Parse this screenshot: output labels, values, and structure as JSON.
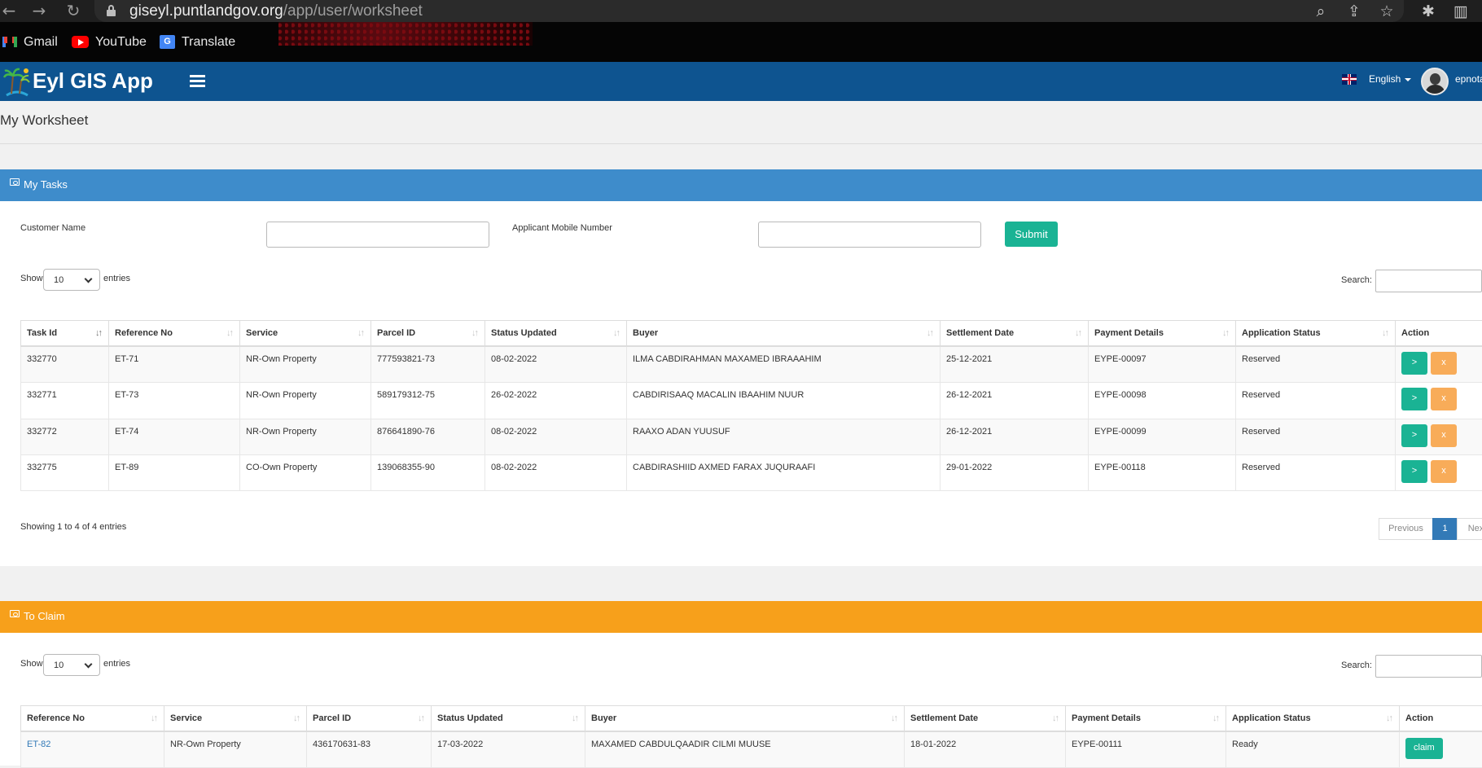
{
  "browser": {
    "url_domain": "giseyl.puntlandgov.org",
    "url_path": "/app/user/worksheet",
    "icons": [
      "back-icon",
      "forward-icon",
      "reload-icon",
      "lock-icon",
      "zoom-icon",
      "share-icon",
      "star-icon",
      "extensions-icon",
      "sidepanel-icon"
    ],
    "bookmarks": [
      {
        "label": "Gmail",
        "icon": "gmail-icon"
      },
      {
        "label": "YouTube",
        "icon": "youtube-icon"
      },
      {
        "label": "Translate",
        "icon": "translate-icon"
      }
    ],
    "translate_glyph": "G"
  },
  "header": {
    "app_title": "Eyl GIS App",
    "language": "English",
    "user": "epnota",
    "color": "#0e5490"
  },
  "page": {
    "title": "My Worksheet"
  },
  "tasks": {
    "panel_title": "My Tasks",
    "panel_color": "#3e8ccb",
    "filters": {
      "customer_name_label": "Customer Name",
      "customer_name_value": "",
      "mobile_label": "Applicant Mobile Number",
      "mobile_value": "",
      "submit_label": "Submit"
    },
    "show_label": "Show",
    "entries_label": "entries",
    "page_length": "10",
    "search_label": "Search:",
    "columns": [
      "Task Id",
      "Reference No",
      "Service",
      "Parcel ID",
      "Status Updated",
      "Buyer",
      "Settlement Date",
      "Payment Details",
      "Application Status",
      "Action"
    ],
    "rows": [
      {
        "task_id": "332770",
        "ref": "ET-71",
        "service": "NR-Own Property",
        "parcel": "777593821-73",
        "status_updated": "08-02-2022",
        "buyer": "ILMA CABDIRAHMAN MAXAMED IBRAAAHIM",
        "settlement": "25-12-2021",
        "payment": "EYPE-00097",
        "app_status": "Reserved"
      },
      {
        "task_id": "332771",
        "ref": "ET-73",
        "service": "NR-Own Property",
        "parcel": "589179312-75",
        "status_updated": "26-02-2022",
        "buyer": "CABDIRISAAQ MACALIN IBAAHIM NUUR",
        "settlement": "26-12-2021",
        "payment": "EYPE-00098",
        "app_status": "Reserved"
      },
      {
        "task_id": "332772",
        "ref": "ET-74",
        "service": "NR-Own Property",
        "parcel": "876641890-76",
        "status_updated": "08-02-2022",
        "buyer": "RAAXO ADAN YUUSUF",
        "settlement": "26-12-2021",
        "payment": "EYPE-00099",
        "app_status": "Reserved"
      },
      {
        "task_id": "332775",
        "ref": "ET-89",
        "service": "CO-Own Property",
        "parcel": "139068355-90",
        "status_updated": "08-02-2022",
        "buyer": "CABDIRASHIID AXMED FARAX JUQURAAFI",
        "settlement": "29-01-2022",
        "payment": "EYPE-00118",
        "app_status": "Reserved"
      }
    ],
    "go_label": ">",
    "cancel_label": "x",
    "info": "Showing 1 to 4 of 4 entries",
    "pagination": {
      "previous": "Previous",
      "current": "1",
      "next": "Next"
    }
  },
  "claim": {
    "panel_title": "To Claim",
    "panel_color": "#f7a01b",
    "show_label": "Show",
    "entries_label": "entries",
    "page_length": "10",
    "search_label": "Search:",
    "columns": [
      "Reference No",
      "Service",
      "Parcel ID",
      "Status Updated",
      "Buyer",
      "Settlement Date",
      "Payment Details",
      "Application Status",
      "Action"
    ],
    "rows": [
      {
        "ref": "ET-82",
        "service": "NR-Own Property",
        "parcel": "436170631-83",
        "status_updated": "17-03-2022",
        "buyer": "MAXAMED CABDULQAADIR CILMI MUUSE",
        "settlement": "18-01-2022",
        "payment": "EYPE-00111",
        "app_status": "Ready"
      }
    ],
    "claim_label": "claim"
  }
}
